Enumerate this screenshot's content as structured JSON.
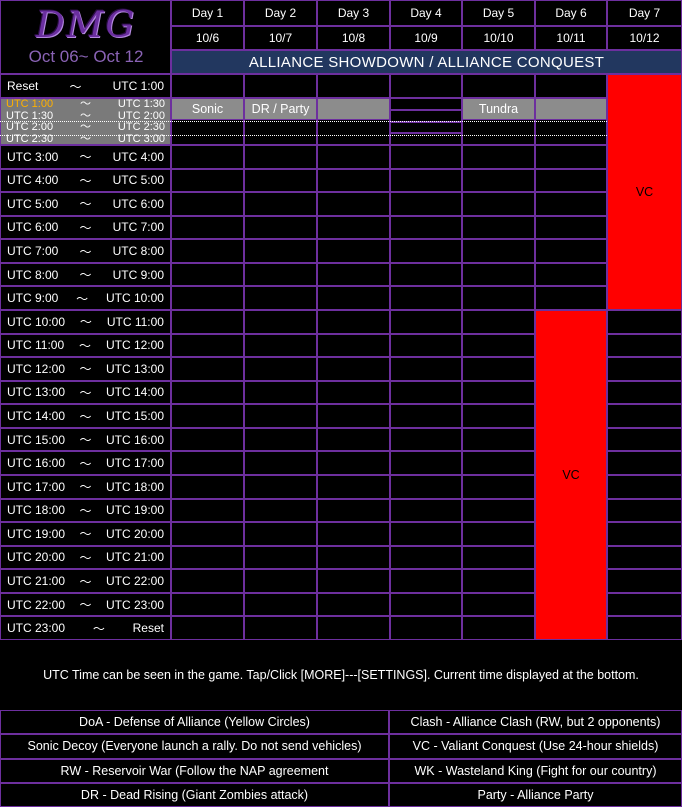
{
  "logo": {
    "text": "DMG",
    "date_range": "Oct 06~ Oct 12"
  },
  "days": [
    {
      "label": "Day 1",
      "date": "10/6"
    },
    {
      "label": "Day 2",
      "date": "10/7"
    },
    {
      "label": "Day 3",
      "date": "10/8"
    },
    {
      "label": "Day 4",
      "date": "10/9"
    },
    {
      "label": "Day 5",
      "date": "10/10"
    },
    {
      "label": "Day 6",
      "date": "10/11"
    },
    {
      "label": "Day 7",
      "date": "10/12"
    }
  ],
  "banner": "ALLIANCE SHOWDOWN / ALLIANCE CONQUEST",
  "tilde": "〜",
  "first_row": {
    "start": "Reset",
    "end": "UTC 1:00"
  },
  "compressed_rows": [
    {
      "start": "UTC 1:00",
      "end": "UTC 1:30",
      "highlight": "#ffb000"
    },
    {
      "start": "UTC 1:30",
      "end": "UTC 2:00"
    },
    {
      "start": "UTC 2:00",
      "end": "UTC 2:30"
    },
    {
      "start": "UTC 2:30",
      "end": "UTC 3:00"
    }
  ],
  "hour_rows": [
    {
      "start": "UTC 3:00",
      "end": "UTC 4:00"
    },
    {
      "start": "UTC 4:00",
      "end": "UTC 5:00"
    },
    {
      "start": "UTC 5:00",
      "end": "UTC 6:00"
    },
    {
      "start": "UTC 6:00",
      "end": "UTC 7:00"
    },
    {
      "start": "UTC 7:00",
      "end": "UTC 8:00"
    },
    {
      "start": "UTC 8:00",
      "end": "UTC 9:00"
    },
    {
      "start": "UTC 9:00",
      "end": "UTC 10:00"
    },
    {
      "start": "UTC 10:00",
      "end": "UTC 11:00"
    },
    {
      "start": "UTC 11:00",
      "end": "UTC 12:00"
    },
    {
      "start": "UTC 12:00",
      "end": "UTC 13:00"
    },
    {
      "start": "UTC 13:00",
      "end": "UTC 14:00"
    },
    {
      "start": "UTC 14:00",
      "end": "UTC 15:00"
    },
    {
      "start": "UTC 15:00",
      "end": "UTC 16:00"
    },
    {
      "start": "UTC 16:00",
      "end": "UTC 17:00"
    },
    {
      "start": "UTC 17:00",
      "end": "UTC 18:00"
    },
    {
      "start": "UTC 18:00",
      "end": "UTC 19:00"
    },
    {
      "start": "UTC 19:00",
      "end": "UTC 20:00"
    },
    {
      "start": "UTC 20:00",
      "end": "UTC 21:00"
    },
    {
      "start": "UTC 21:00",
      "end": "UTC 22:00"
    },
    {
      "start": "UTC 22:00",
      "end": "UTC 23:00"
    },
    {
      "start": "UTC 23:00",
      "end": "Reset"
    }
  ],
  "events": {
    "sonic": "Sonic",
    "dr_party": "DR / Party",
    "tundra": "Tundra",
    "vc_day7": "VC",
    "vc_day6": "VC"
  },
  "colors": {
    "grid": "#6d2f9e",
    "event_gray": "#8c8c8c",
    "vc_red": "#ff0000",
    "banner": "#22375f",
    "highlight": "#ffb000"
  },
  "note": "UTC Time can be seen in the game. Tap/Click [MORE]---[SETTINGS]. Current time displayed at the bottom.",
  "legend": [
    [
      "DoA - Defense of Alliance (Yellow Circles)",
      "Clash - Alliance Clash (RW, but 2 opponents)"
    ],
    [
      "Sonic Decoy (Everyone launch a rally. Do not send vehicles)",
      "VC - Valiant Conquest (Use 24-hour shields)"
    ],
    [
      "RW - Reservoir War (Follow the NAP agreement",
      "WK - Wasteland King (Fight for our country)"
    ],
    [
      "DR - Dead Rising (Giant Zombies attack)",
      "Party - Alliance Party"
    ]
  ]
}
